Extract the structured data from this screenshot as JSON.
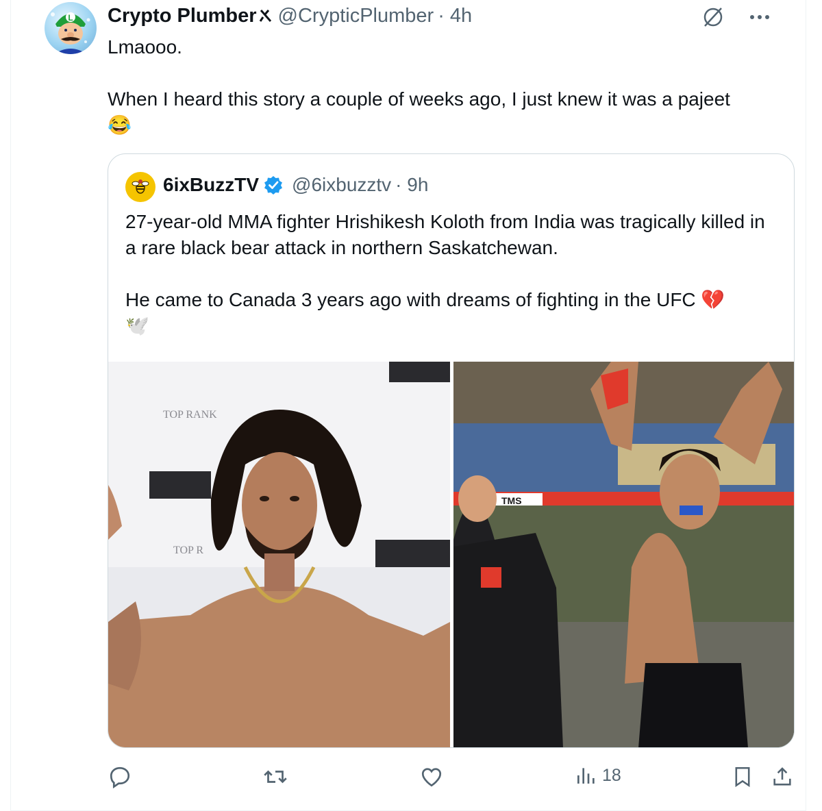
{
  "author": {
    "name": "Crypto Plumber",
    "handle": "@CrypticPlumber",
    "time": "· 4h",
    "badge_icon": "grok-icon",
    "brand_color": "#1d9bf0"
  },
  "tweet": {
    "line1": "Lmaooo.",
    "line2": "When I heard this story a couple of weeks ago, I just knew it was a pajeet",
    "emoji": "😂"
  },
  "quoted": {
    "name": "6ixBuzzTV",
    "handle": "@6ixbuzztv",
    "time": "· 9h",
    "verified_color": "#1d9bf0",
    "paragraph1": "27-year-old MMA fighter Hrishikesh Koloth from India was tragically killed in a rare black bear attack in northern Saskatchewan.",
    "paragraph2": "He came to Canada 3 years ago with dreams of fighting in the UFC 💔",
    "dove_emoji": "🕊️",
    "photo_left_banner_text": "TOP RANK",
    "photo_right_banner_text": "TMS"
  },
  "actions": {
    "reply_icon": "reply-icon",
    "retweet_icon": "retweet-icon",
    "like_icon": "heart-icon",
    "views_icon": "views-icon",
    "views_count": "18",
    "bookmark_icon": "bookmark-icon",
    "share_icon": "share-icon"
  }
}
